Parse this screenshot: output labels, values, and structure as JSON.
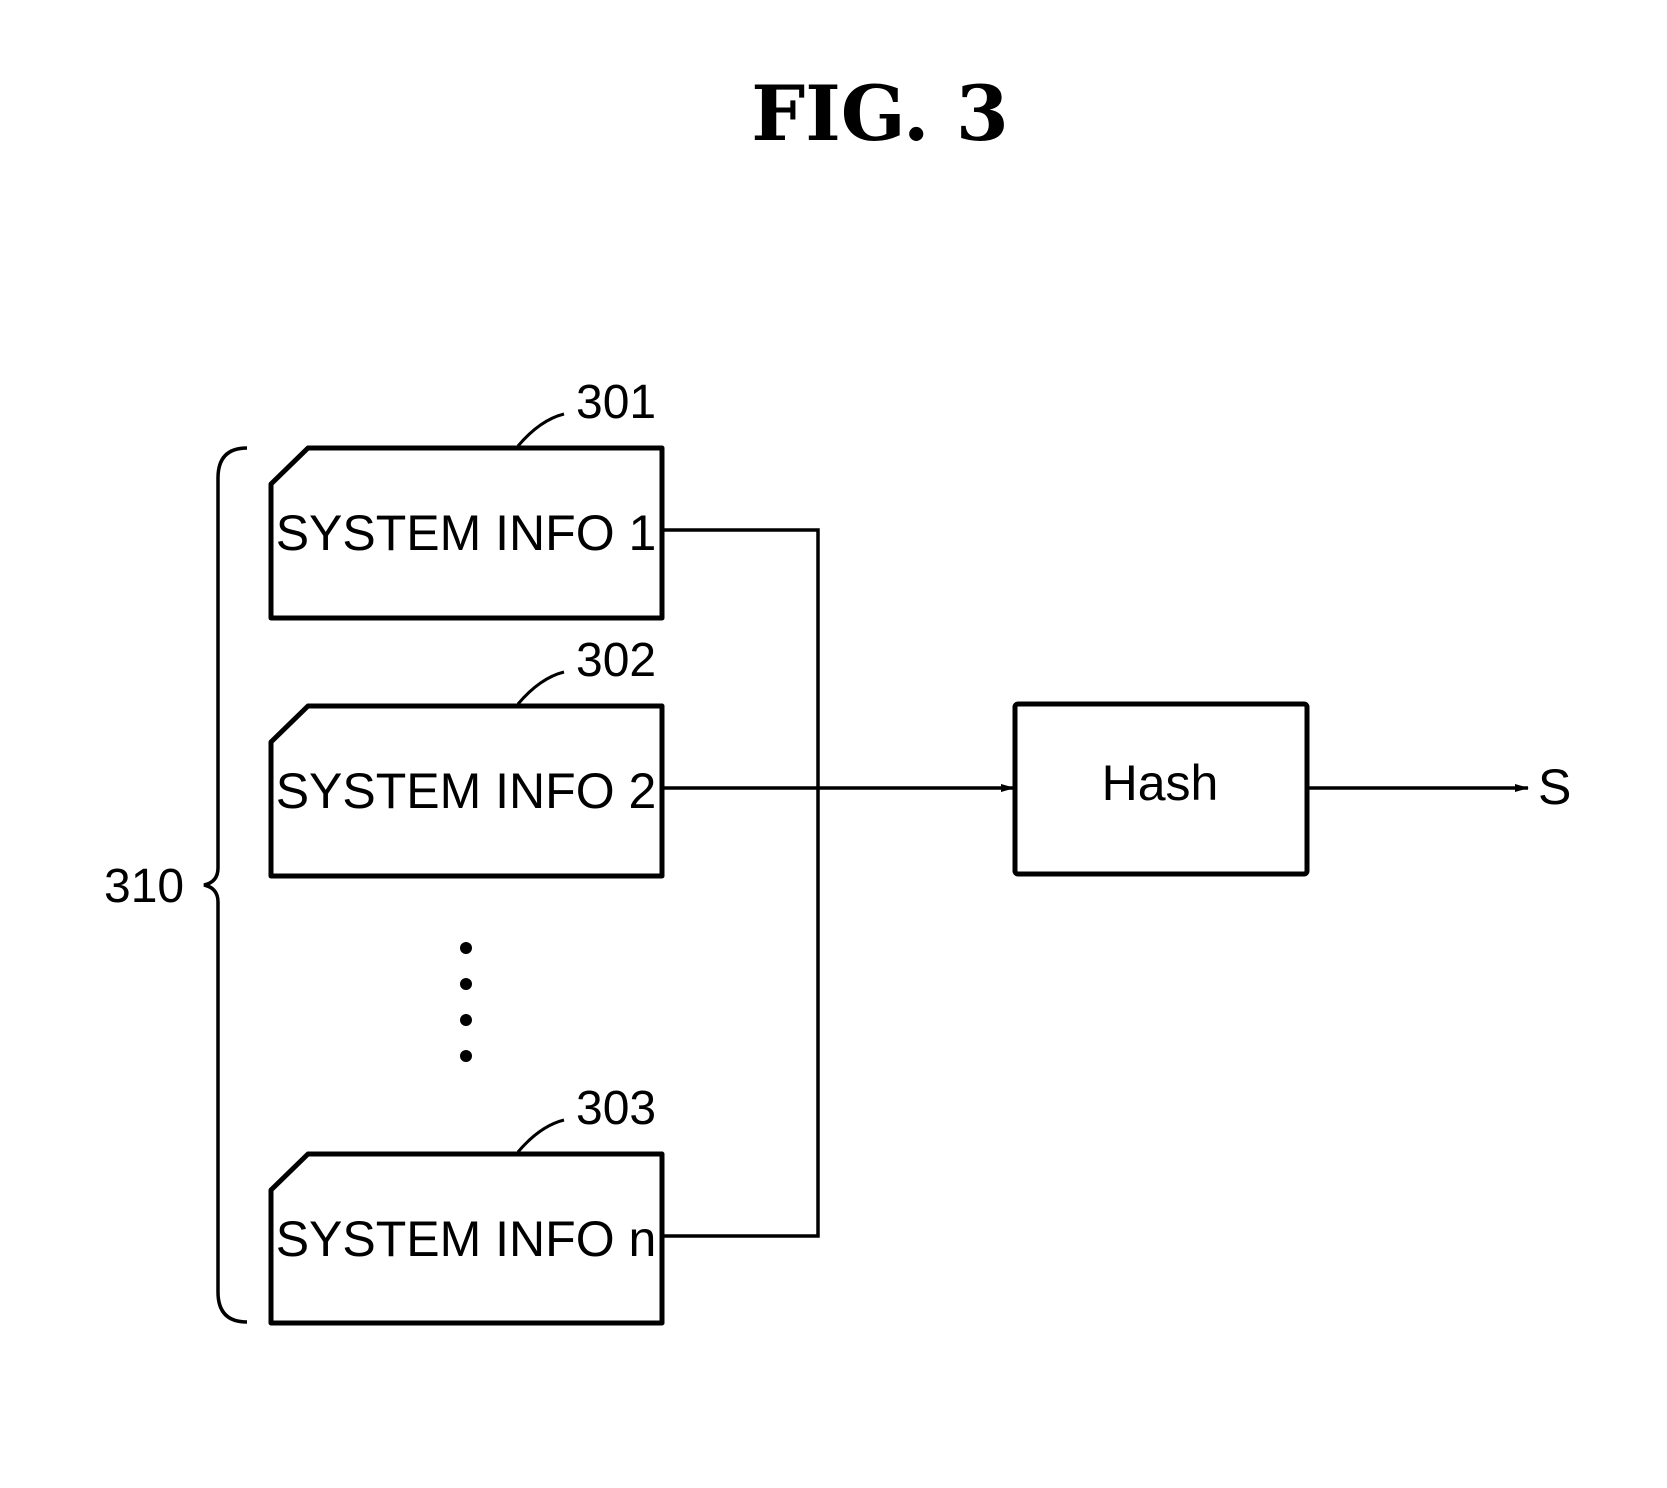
{
  "figure": {
    "title": "FIG.  3"
  },
  "group": {
    "ref": "310"
  },
  "blocks": [
    {
      "ref": "301",
      "label": "SYSTEM INFO 1"
    },
    {
      "ref": "302",
      "label": "SYSTEM INFO 2"
    },
    {
      "ref": "303",
      "label": "SYSTEM INFO n"
    }
  ],
  "hash_block": {
    "label": "Hash"
  },
  "output": {
    "label": "S"
  },
  "ellipsis": {
    "icon": "vertical-ellipsis-icon"
  }
}
